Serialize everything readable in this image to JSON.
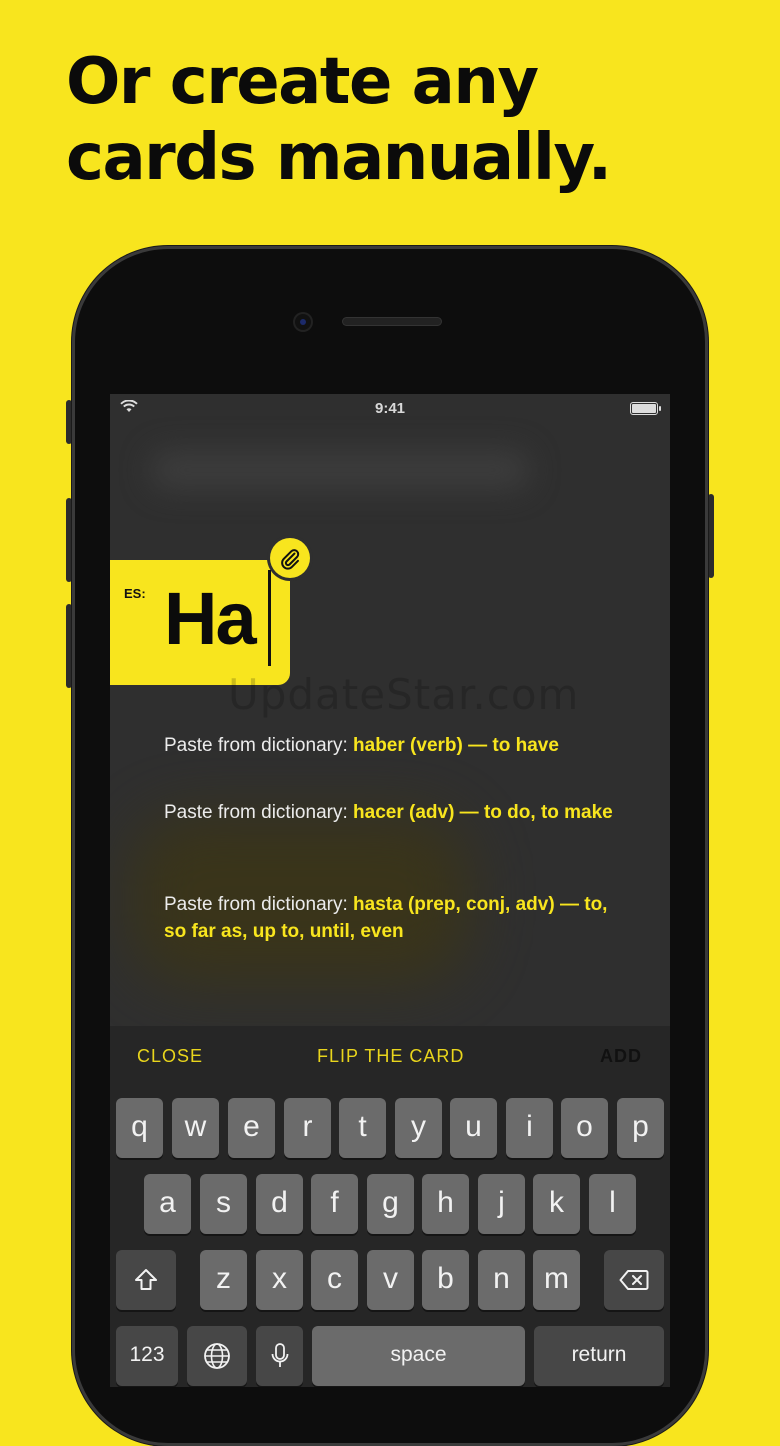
{
  "headline": {
    "line1": "Or create any",
    "line2": "cards manually."
  },
  "status_bar": {
    "time": "9:41"
  },
  "card": {
    "language": "ES:",
    "word": "Ha"
  },
  "watermark": "UpdateStar.com",
  "suggestions": [
    {
      "prefix": "Paste from dictionary: ",
      "value": "haber (verb) — to have"
    },
    {
      "prefix": "Paste from dictionary: ",
      "value": "hacer (adv) — to do, to make"
    },
    {
      "prefix": "Paste from dictionary: ",
      "value": "hasta (prep, conj, adv) — to, so far as, up to, until, even"
    }
  ],
  "toolbar": {
    "close": "CLOSE",
    "flip": "FLIP THE CARD",
    "add": "ADD"
  },
  "keyboard": {
    "row1": [
      "q",
      "w",
      "e",
      "r",
      "t",
      "y",
      "u",
      "i",
      "o",
      "p"
    ],
    "row2": [
      "a",
      "s",
      "d",
      "f",
      "g",
      "h",
      "j",
      "k",
      "l"
    ],
    "row3": [
      "z",
      "x",
      "c",
      "v",
      "b",
      "n",
      "m"
    ],
    "numbers": "123",
    "space": "space",
    "return": "return"
  },
  "icons": {
    "clip": "paperclip-icon",
    "shift": "shift-icon",
    "delete": "backspace-icon",
    "globe": "globe-icon",
    "mic": "microphone-icon",
    "wifi": "wifi-icon",
    "battery": "battery-icon"
  },
  "colors": {
    "brand_yellow": "#f8e51e",
    "screen_bg": "#2f2f2f",
    "key": "#6b6b6b"
  }
}
